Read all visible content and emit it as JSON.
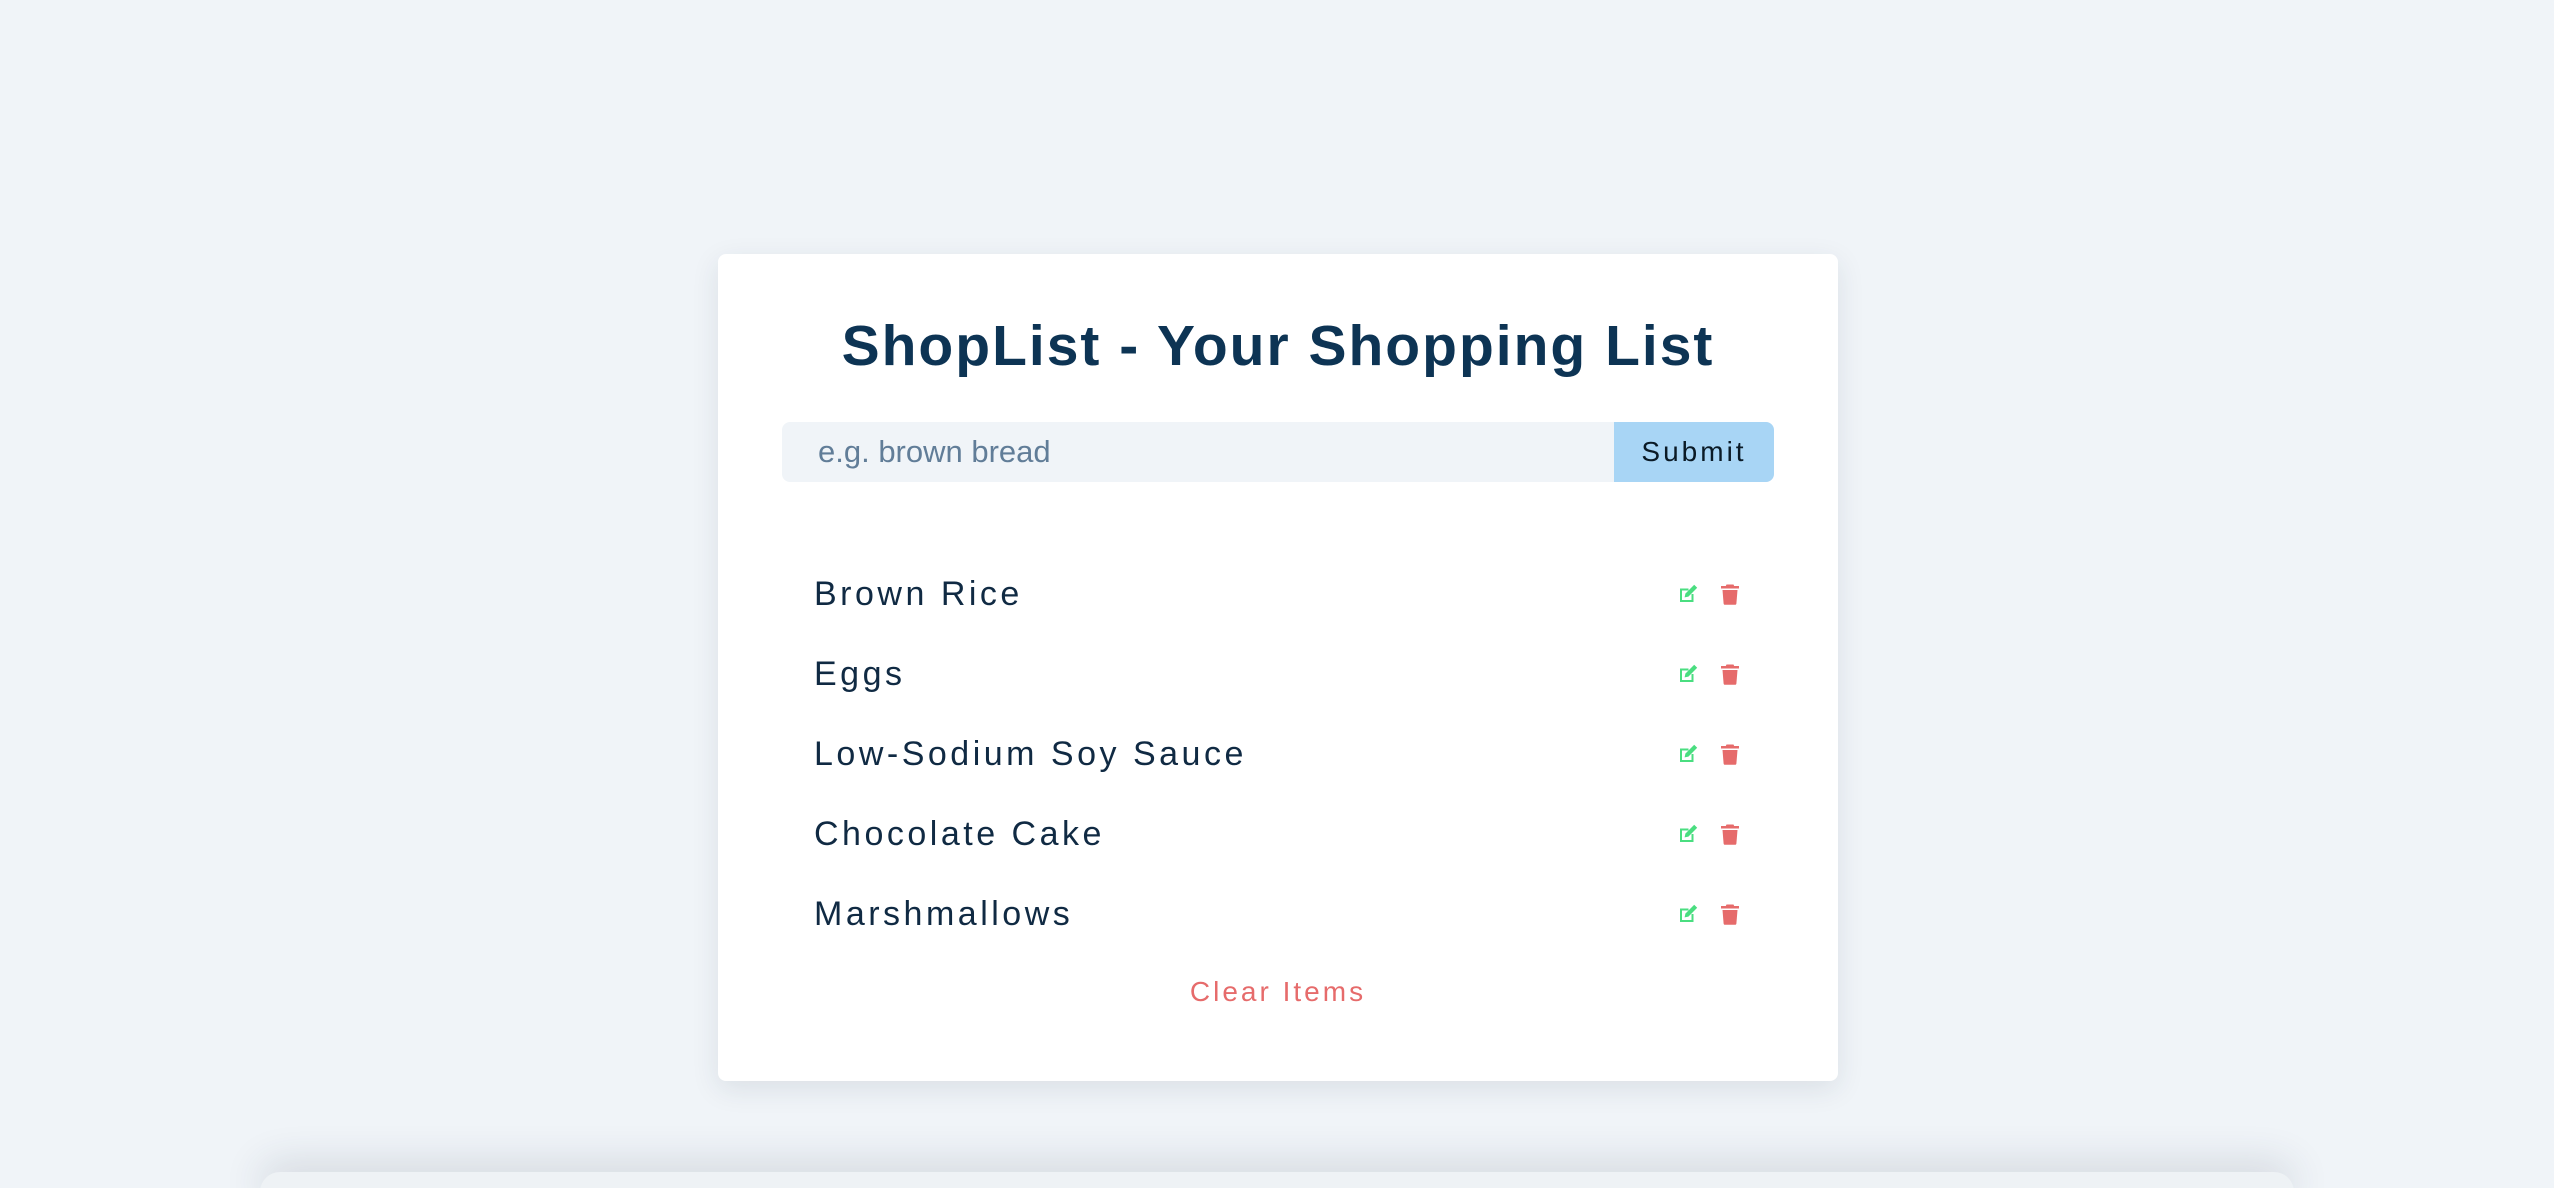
{
  "app": {
    "title": "ShopList - Your Shopping List"
  },
  "form": {
    "input_value": "",
    "input_placeholder": "e.g. brown bread",
    "submit_label": "Submit"
  },
  "items": [
    {
      "name": "Brown Rice"
    },
    {
      "name": "Eggs"
    },
    {
      "name": "Low-Sodium Soy Sauce"
    },
    {
      "name": "Chocolate Cake"
    },
    {
      "name": "Marshmallows"
    }
  ],
  "icons": {
    "edit": "edit-icon",
    "delete": "trash-icon"
  },
  "clear_label": "Clear Items",
  "colors": {
    "background": "#f0f4f8",
    "title": "#0d3454",
    "submit_bg": "#a8d5f5",
    "edit_icon": "#4ade80",
    "delete_icon": "#e66b6b",
    "clear_text": "#e66b6b",
    "item_text": "#102a43"
  }
}
